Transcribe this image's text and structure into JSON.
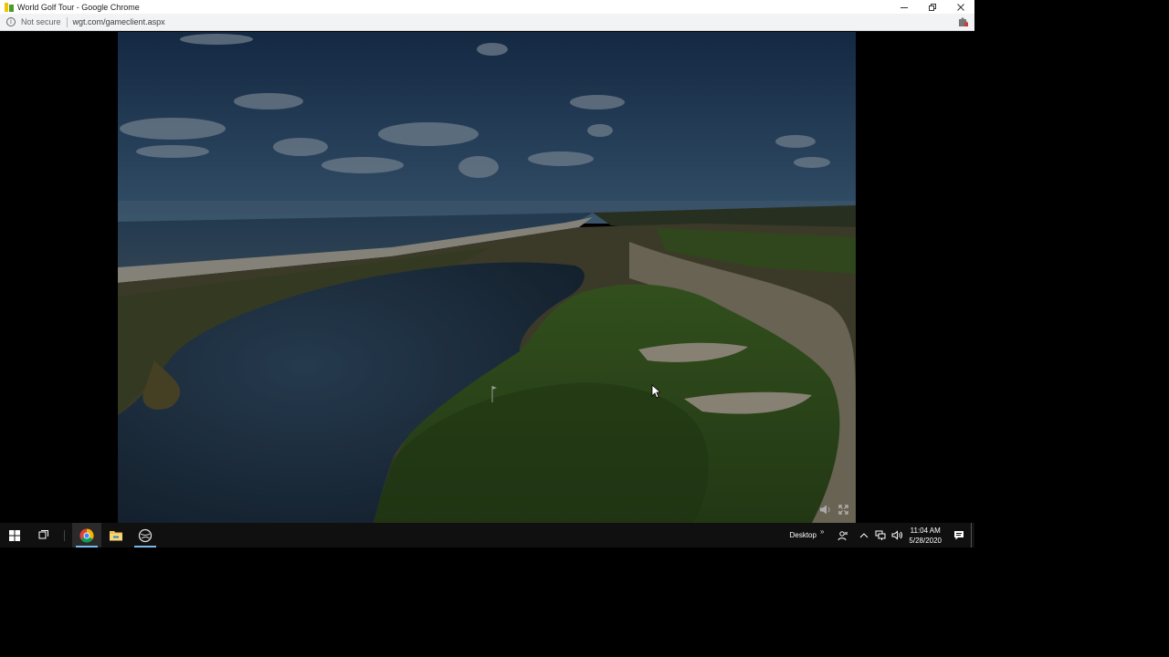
{
  "window": {
    "title": "World Golf Tour - Google Chrome",
    "minimize_icon": "minimize-icon",
    "restore_icon": "restore-icon",
    "close_icon": "close-icon"
  },
  "addressbar": {
    "security_label": "Not secure",
    "url": "wgt.com/gameclient.aspx",
    "extension_icon": "puzzle-extension-icon"
  },
  "game": {
    "scene": "aerial golf course photo",
    "sound_icon": "speaker-icon",
    "fullscreen_icon": "fullscreen-icon"
  },
  "taskbar": {
    "apps": [
      {
        "name": "chrome",
        "icon": "chrome-icon",
        "active": true
      },
      {
        "name": "file-explorer",
        "icon": "folder-icon",
        "active": false
      },
      {
        "name": "wgt-client",
        "icon": "golf-ball-icon",
        "active": false
      }
    ],
    "desktop_label": "Desktop",
    "chevrons": "»",
    "time": "11:04 AM",
    "date": "5/28/2020"
  },
  "colors": {
    "taskbar_bg": "#101010",
    "active_underline": "#76b9ed",
    "sky_top": "#1f3e66",
    "water": "#2b4660",
    "green": "#3e6226"
  }
}
